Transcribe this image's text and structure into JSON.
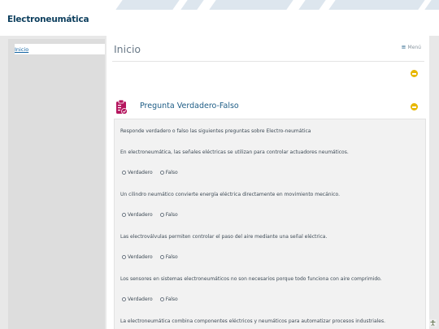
{
  "app": {
    "title": "Electroneumática"
  },
  "sidebar": {
    "items": [
      {
        "label": "Inicio"
      }
    ]
  },
  "main": {
    "title": "Inicio",
    "menu_label": "Menú",
    "menu_icon": "hamburger-icon",
    "question": {
      "title": "Pregunta Verdadero-Falso",
      "icon": "clipboard-check-icon",
      "instructions": "Responde verdadero o falso las siguientes preguntas sobre Electro-neumática",
      "items": [
        {
          "statement": "En electroneumática, las señales eléctricas se utilizan para controlar actuadores neumáticos.",
          "opt_true": "Verdadero",
          "opt_false": "Falso"
        },
        {
          "statement": "Un cilindro neumático convierte energía eléctrica directamente en movimiento mecánico.",
          "opt_true": "Verdadero",
          "opt_false": "Falso"
        },
        {
          "statement": "Las electroválvulas permiten controlar el paso del aire mediante una señal eléctrica.",
          "opt_true": "Verdadero",
          "opt_false": "Falso"
        },
        {
          "statement": "Los sensores en sistemas electroneumáticos no son necesarios porque todo funciona con aire comprimido.",
          "opt_true": "Verdadero",
          "opt_false": "Falso"
        },
        {
          "statement": "La electroneumática combina componentes eléctricos y neumáticos para automatizar procesos industriales."
        }
      ]
    }
  },
  "colors": {
    "accent": "#1e5d86",
    "toggle": "#e7b700",
    "icon": "#b5165f"
  }
}
